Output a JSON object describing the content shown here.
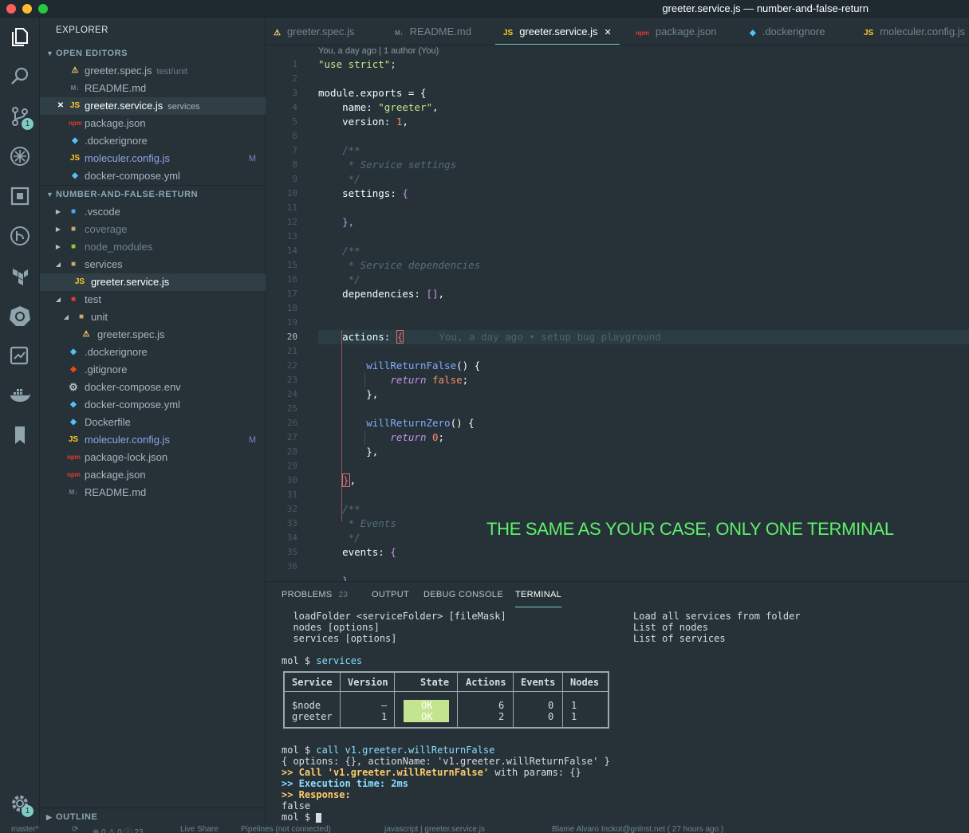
{
  "window": {
    "title": "greeter.service.js — number-and-false-return"
  },
  "activity_bar": {
    "scm_badge": "1",
    "settings_badge": "1"
  },
  "explorer": {
    "header": "EXPLORER",
    "open_editors_label": "OPEN EDITORS",
    "open_editors": [
      {
        "name": "greeter.spec.js",
        "sub": "test/unit",
        "icon": "spec"
      },
      {
        "name": "README.md",
        "sub": "",
        "icon": "md"
      },
      {
        "name": "greeter.service.js",
        "sub": "services",
        "icon": "js",
        "close": "✕"
      },
      {
        "name": "package.json",
        "sub": "",
        "icon": "npm"
      },
      {
        "name": ".dockerignore",
        "sub": "",
        "icon": "docker"
      },
      {
        "name": "moleculer.config.js",
        "sub": "",
        "icon": "js",
        "mark": "M"
      },
      {
        "name": "docker-compose.yml",
        "sub": "",
        "icon": "docker"
      }
    ],
    "project_label": "NUMBER-AND-FALSE-RETURN",
    "tree": [
      {
        "name": ".vscode"
      },
      {
        "name": "coverage"
      },
      {
        "name": "node_modules"
      },
      {
        "name": "services"
      },
      {
        "name": "greeter.service.js"
      },
      {
        "name": "test"
      },
      {
        "name": "unit"
      },
      {
        "name": "greeter.spec.js"
      },
      {
        "name": ".dockerignore"
      },
      {
        "name": ".gitignore"
      },
      {
        "name": "docker-compose.env"
      },
      {
        "name": "docker-compose.yml"
      },
      {
        "name": "Dockerfile"
      },
      {
        "name": "moleculer.config.js",
        "mark": "M"
      },
      {
        "name": "package-lock.json"
      },
      {
        "name": "package.json"
      },
      {
        "name": "README.md"
      }
    ],
    "outline_label": "OUTLINE"
  },
  "tabs": [
    {
      "label": "greeter.spec.js",
      "icon_text": ""
    },
    {
      "label": "README.md",
      "icon_text": "M↓"
    },
    {
      "label": "greeter.service.js",
      "icon_text": "JS",
      "close": "✕"
    },
    {
      "label": "package.json",
      "icon_text": ""
    },
    {
      "label": ".dockerignore",
      "icon_text": ""
    },
    {
      "label": "moleculer.config.js",
      "icon_text": "JS"
    }
  ],
  "editor": {
    "blame_header": "You, a day ago | 1 author (You)",
    "current_line": "20",
    "inline_blame": "You, a day ago • setup bug playground",
    "line_numbers": [
      "1",
      "2",
      "3",
      "4",
      "5",
      "6",
      "7",
      "8",
      "9",
      "10",
      "11",
      "12",
      "13",
      "14",
      "15",
      "16",
      "17",
      "18",
      "19",
      "20",
      "21",
      "22",
      "23",
      "24",
      "25",
      "26",
      "27",
      "28",
      "29",
      "30",
      "31",
      "32",
      "33",
      "34",
      "35",
      "36"
    ],
    "tokens": {
      "use_strict": "\"use strict\";",
      "module_exports": "module.exports = {",
      "name_key": "name: ",
      "name_val": "\"greeter\"",
      "comma": ",",
      "version_key": "version: ",
      "version_val": "1",
      "doc_open": "/**",
      "doc_close": "*/",
      "settings_comment": "* Service settings",
      "settings_key": "settings: ",
      "open_brace": "{",
      "close_brace_comma": "},",
      "deps_comment": "* Service dependencies",
      "deps_key": "dependencies: ",
      "deps_val": "[]",
      "actions_key": "actions: ",
      "fn_false": "willReturnFalse",
      "fn_zero": "willReturnZero",
      "fn_sig": "() {",
      "return_kw": "return ",
      "false_val": "false",
      "zero_val": "0",
      "semi": ";",
      "events_comment": "* Events",
      "events_key": "events: ",
      "close_brace": "}"
    }
  },
  "overlay_text": "THE SAME AS YOUR CASE, ONLY ONE TERMINAL",
  "panel": {
    "tabs": [
      {
        "label": "PROBLEMS",
        "badge": "23"
      },
      {
        "label": "OUTPUT"
      },
      {
        "label": "DEBUG CONSOLE"
      },
      {
        "label": "TERMINAL"
      }
    ],
    "help_lines": [
      {
        "cmd": "  loadFolder <serviceFolder> [fileMask]",
        "desc": "Load all services from folder"
      },
      {
        "cmd": "  nodes [options]",
        "desc": "List of nodes"
      },
      {
        "cmd": "  services [options]",
        "desc": "List of services"
      }
    ],
    "prompt": "mol $ ",
    "cmd1": "services",
    "table": {
      "headers": [
        "Service",
        "Version",
        "State",
        "Actions",
        "Events",
        "Nodes"
      ],
      "rows": [
        {
          "service": "$node",
          "version": "–",
          "state": "OK",
          "actions": "6",
          "events": "0",
          "nodes": "1"
        },
        {
          "service": "greeter",
          "version": "1",
          "state": "OK",
          "actions": "2",
          "events": "0",
          "nodes": "1"
        }
      ]
    },
    "cmd2": "call v1.greeter.willReturnFalse",
    "out_options": "{ options: {}, actionName: 'v1.greeter.willReturnFalse' }",
    "out_call_a": ">> Call ",
    "out_call_b": "'v1.greeter.willReturnFalse'",
    "out_call_c": " with params: {}",
    "out_exec_a": ">> Execution time: ",
    "out_exec_b": "2ms",
    "out_resp": ">> Response:",
    "out_value": "false"
  },
  "statusbar": {
    "branch": "master*",
    "sync": "⟳",
    "problems": "⊗ 0 ⚠ 0 ⓘ 23",
    "liveshare": "Live Share",
    "pipelines": "Pipelines (not connected)",
    "lang": "javascript | greeter.service.js",
    "blame": "Blame Alvaro Inckot@gnlnst.net ( 27 hours ago )"
  },
  "colors": {
    "accent": "#80cbc4",
    "string": "#c3e88d",
    "keyword": "#c792ea",
    "number": "#f78c6c",
    "overlay": "#5ff06b",
    "state_ok": "#c5e48f"
  }
}
